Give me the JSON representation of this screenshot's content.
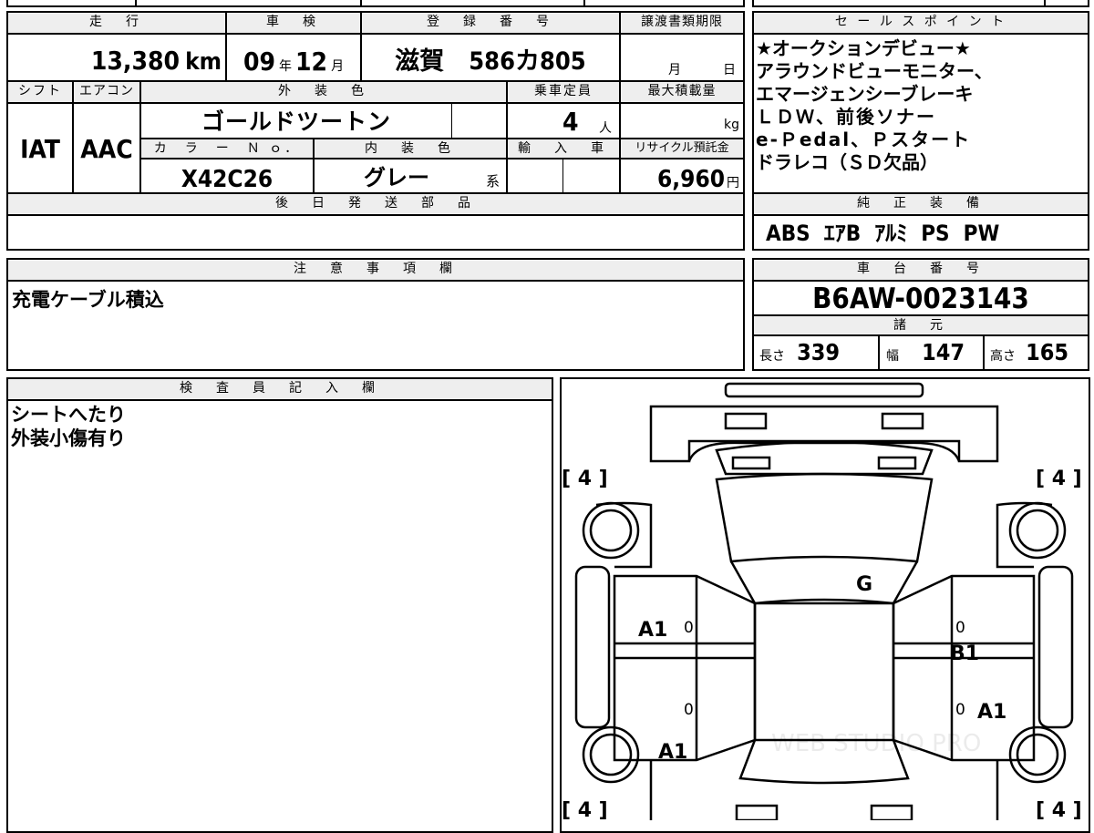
{
  "labels": {
    "mileage": "走　行",
    "shaken": "車　検",
    "reg_no": "登　録　番　号",
    "transfer_deadline": "譲渡書類期限",
    "shift": "シフト",
    "aircon": "エアコン",
    "ext_color": "外　装　色",
    "capacity": "乗車定員",
    "max_load": "最大積載量",
    "color_no": "カ　ラ　ー　Ｎ ｏ．",
    "int_color": "内　装　色",
    "import": "輸　入　車",
    "recycle": "リサイクル預託金",
    "later_parts": "後　日　発　送　部　品",
    "notes": "注　意　事　項　欄",
    "inspector": "検　査　員　記　入　欄",
    "sales_points": "セ ー ル ス ポ イ ン ト",
    "std_equipment": "純　正　装　備",
    "chassis": "車　台　番　号",
    "specs": "諸　元"
  },
  "vehicle": {
    "mileage_value": "13,380",
    "mileage_unit": "km",
    "shaken_year": "09",
    "shaken_year_unit": "年",
    "shaken_month": "12",
    "shaken_month_unit": "月",
    "registration": "滋賀　586カ805",
    "deadline_month": "月",
    "deadline_day": "日",
    "shift": "IAT",
    "aircon": "AAC",
    "ext_color": "ゴールドツートン",
    "capacity": "4",
    "capacity_unit": "人",
    "max_load_unit": "kg",
    "color_no": "X42C26",
    "int_color": "グレー",
    "int_color_suffix": "系",
    "recycle_fee": "6,960",
    "recycle_unit": "円"
  },
  "sales_points": [
    "★オークションデビュー★",
    "アラウンドビューモニター、",
    "エマージェンシーブレーキ",
    "ＬＤＷ、前後ソナー",
    "e-Ｐedal、Ｐスタート",
    "ドラレコ（ＳＤ欠品）"
  ],
  "std_equipment": "ABS  ｴｱB  ｱﾙﾐ  PS  PW",
  "notes_text": "充電ケーブル積込",
  "chassis_no": "B6AW-0023143",
  "specs": {
    "length_label": "長さ",
    "length": "339",
    "width_label": "幅",
    "width": "147",
    "height_label": "高さ",
    "height": "165"
  },
  "inspector_lines": [
    "シートへたり",
    "外装小傷有り"
  ],
  "diagram": {
    "tires": [
      "[ 4 ]",
      "[ 4 ]",
      "[ 4 ]",
      "[ 4 ]"
    ],
    "marks": [
      "G",
      "A1",
      "B1",
      "A1",
      "A1"
    ],
    "zeros": [
      "0",
      "0",
      "0",
      "0"
    ],
    "watermark": "WEB STUDIO PRO"
  }
}
